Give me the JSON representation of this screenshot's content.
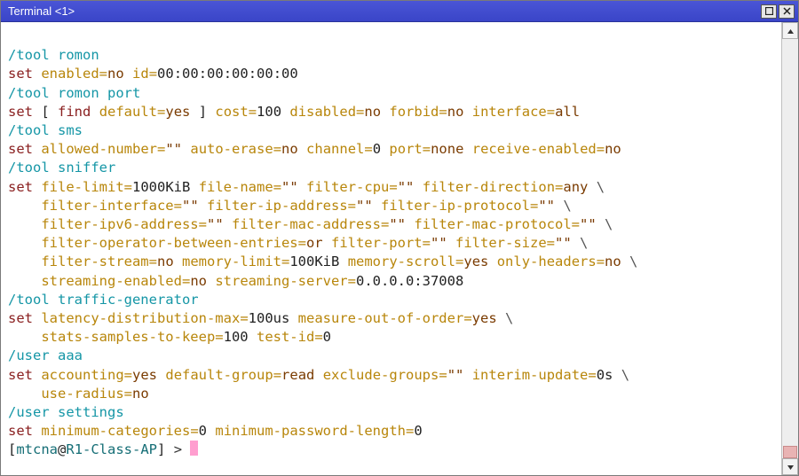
{
  "window": {
    "title": "Terminal <1>"
  },
  "kw": {
    "set": "set",
    "find": "find"
  },
  "sec": {
    "romon": "/tool romon",
    "romon_port": "/tool romon port",
    "sms": "/tool sms",
    "sniffer": "/tool sniffer",
    "tgen": "/tool traffic-generator",
    "useraaa": "/user aaa",
    "usersettings": "/user settings"
  },
  "romon": {
    "enabled_k": "enabled",
    "enabled_v": "no",
    "id_k": "id",
    "id_v": "00:00:00:00:00:00"
  },
  "romon_port": {
    "default_k": "default",
    "default_v": "yes",
    "cost_k": "cost",
    "cost_v": "100",
    "disabled_k": "disabled",
    "disabled_v": "no",
    "forbid_k": "forbid",
    "forbid_v": "no",
    "interface_k": "interface",
    "interface_v": "all",
    "lbr": "[ ",
    "rbr": " ] "
  },
  "sms": {
    "allowed_k": "allowed-number",
    "allowed_v": "\"\"",
    "autoerase_k": "auto-erase",
    "autoerase_v": "no",
    "channel_k": "channel",
    "channel_v": "0",
    "port_k": "port",
    "port_v": "none",
    "recv_k": "receive-enabled",
    "recv_v": "no"
  },
  "sniffer": {
    "filelimit_k": "file-limit",
    "filelimit_v": "1000KiB",
    "filename_k": "file-name",
    "filename_v": "\"\"",
    "fcpu_k": "filter-cpu",
    "fcpu_v": "\"\"",
    "fdir_k": "filter-direction",
    "fdir_v": "any",
    "fint_k": "filter-interface",
    "fint_v": "\"\"",
    "fip_k": "filter-ip-address",
    "fip_v": "\"\"",
    "fipp_k": "filter-ip-protocol",
    "fipp_v": "\"\"",
    "fip6_k": "filter-ipv6-address",
    "fip6_v": "\"\"",
    "fmac_k": "filter-mac-address",
    "fmac_v": "\"\"",
    "fmacp_k": "filter-mac-protocol",
    "fmacp_v": "\"\"",
    "fop_k": "filter-operator-between-entries",
    "fop_v": "or",
    "fport_k": "filter-port",
    "fport_v": "\"\"",
    "fsize_k": "filter-size",
    "fsize_v": "\"\"",
    "fstream_k": "filter-stream",
    "fstream_v": "no",
    "memlimit_k": "memory-limit",
    "memlimit_v": "100KiB",
    "memscroll_k": "memory-scroll",
    "memscroll_v": "yes",
    "onlyhead_k": "only-headers",
    "onlyhead_v": "no",
    "stren_k": "streaming-enabled",
    "stren_v": "no",
    "strsrv_k": "streaming-server",
    "strsrv_v": "0.0.0.0:37008"
  },
  "tgen": {
    "lat_k": "latency-distribution-max",
    "lat_v": "100us",
    "moo_k": "measure-out-of-order",
    "moo_v": "yes",
    "ssk_k": "stats-samples-to-keep",
    "ssk_v": "100",
    "tid_k": "test-id",
    "tid_v": "0"
  },
  "useraaa": {
    "acct_k": "accounting",
    "acct_v": "yes",
    "defgrp_k": "default-group",
    "defgrp_v": "read",
    "exgrp_k": "exclude-groups",
    "exgrp_v": "\"\"",
    "intup_k": "interim-update",
    "intup_v": "0s",
    "userad_k": "use-radius",
    "userad_v": "no"
  },
  "usersettings": {
    "mincat_k": "minimum-categories",
    "mincat_v": "0",
    "minpw_k": "minimum-password-length",
    "minpw_v": "0"
  },
  "prompt": {
    "open": "[",
    "user": "mtcna",
    "at": "@",
    "host": "R1-Class-AP",
    "close": "] ",
    "gt": ">"
  },
  "eq": "=",
  "bs": " \\",
  "sp4": "    "
}
